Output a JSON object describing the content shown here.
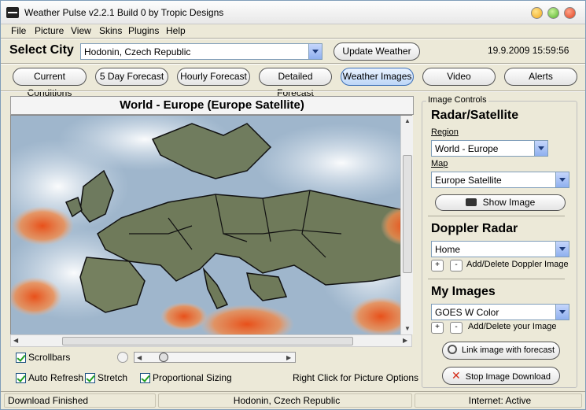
{
  "window": {
    "title": "Weather Pulse v2.2.1 Build 0 by Tropic Designs"
  },
  "menu": {
    "file": "File",
    "picture": "Picture",
    "view": "View",
    "skins": "Skins",
    "plugins": "Plugins",
    "help": "Help"
  },
  "header": {
    "select_city_label": "Select City",
    "city_value": "Hodonin, Czech Republic",
    "update_button": "Update Weather",
    "datetime": "19.9.2009 15:59:56"
  },
  "tabs": [
    {
      "label": "Current Conditions"
    },
    {
      "label": "5 Day Forecast"
    },
    {
      "label": "Hourly Forecast"
    },
    {
      "label": "Detailed Forecast"
    },
    {
      "label": "Weather Images"
    },
    {
      "label": "Video"
    },
    {
      "label": "Alerts"
    }
  ],
  "map": {
    "title": "World - Europe (Europe Satellite)"
  },
  "options": {
    "scrollbars": "Scrollbars",
    "auto_refresh": "Auto Refresh",
    "stretch": "Stretch",
    "proportional_sizing": "Proportional Sizing",
    "right_click_hint": "Right Click for Picture Options",
    "slider_level": 0.1
  },
  "controls": {
    "group_title": "Image Controls",
    "radar_heading": "Radar/Satellite",
    "region_label": "Region",
    "region_value": "World - Europe",
    "map_label": "Map",
    "map_value": "Europe Satellite",
    "show_image_button": "Show Image",
    "doppler_heading": "Doppler Radar",
    "doppler_value": "Home",
    "doppler_add_delete": "Add/Delete Doppler Image",
    "my_images_heading": "My Images",
    "my_images_value": "GOES W Color",
    "my_images_add_delete": "Add/Delete your Image",
    "link_button": "Link image with forecast",
    "stop_button": "Stop Image Download",
    "plus": "+",
    "minus": "-"
  },
  "status": {
    "left": "Download Finished",
    "center": "Hodonin, Czech Republic",
    "right": "Internet: Active"
  }
}
